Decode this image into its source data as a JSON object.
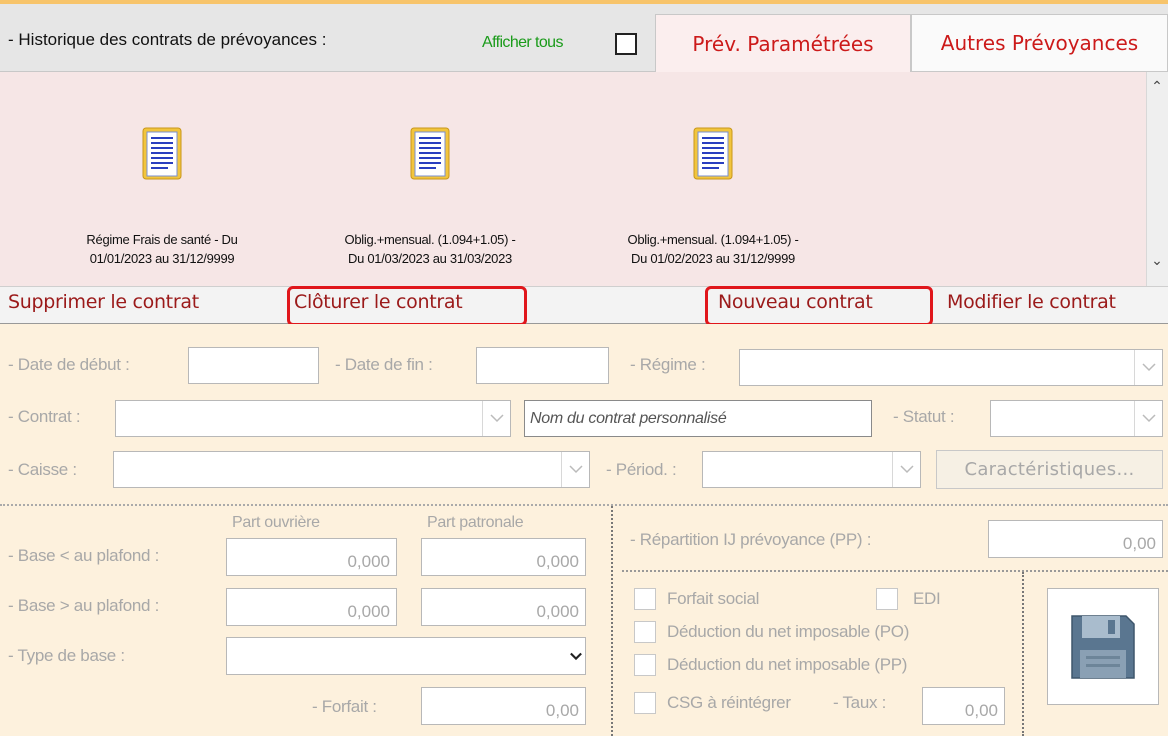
{
  "header": {
    "title": "- Historique des contrats de prévoyances :",
    "show_all_label": "Afficher tous"
  },
  "tabs": [
    {
      "label": "Prév. Paramétrées",
      "active": true
    },
    {
      "label": "Autres Prévoyances",
      "active": false
    }
  ],
  "contracts": [
    {
      "line1": "Régime Frais de santé - Du",
      "line2": "01/01/2023 au 31/12/9999"
    },
    {
      "line1": "Oblig.+mensual. (1.094+1.05) -",
      "line2": "Du 01/03/2023 au 31/03/2023"
    },
    {
      "line1": "Oblig.+mensual. (1.094+1.05) -",
      "line2": "Du 01/02/2023 au 31/12/9999"
    }
  ],
  "actions": {
    "delete": "Supprimer le contrat",
    "close": "Clôturer le contrat",
    "new": "Nouveau contrat",
    "edit": "Modifier le contrat"
  },
  "form": {
    "date_debut_label": "- Date de début :",
    "date_fin_label": "- Date de fin :",
    "regime_label": "- Régime :",
    "contrat_label": "- Contrat :",
    "contrat_placeholder": "Nom du contrat personnalisé",
    "statut_label": "- Statut :",
    "caisse_label": "- Caisse :",
    "period_label": "- Périod. :",
    "caracteristiques": "Caractéristiques...",
    "part_ouvriere": "Part ouvrière",
    "part_patronale": "Part patronale",
    "base_inf_label": "- Base < au plafond :",
    "base_inf_ouv": "0,000",
    "base_inf_pat": "0,000",
    "base_sup_label": "- Base > au plafond :",
    "base_sup_ouv": "0,000",
    "base_sup_pat": "0,000",
    "type_base_label": "- Type de base :",
    "forfait_label": "- Forfait :",
    "forfait_value": "0,00",
    "repartition_label": "- Répartition IJ prévoyance (PP) :",
    "repartition_value": "0,00",
    "forfait_social": "Forfait social",
    "edi": "EDI",
    "deduction_po": "Déduction du net imposable (PO)",
    "deduction_pp": "Déduction du net imposable (PP)",
    "csg": "CSG à réintégrer",
    "taux_label": "- Taux :",
    "taux_value": "0,00"
  },
  "colors": {
    "tab_text": "#cc1a1a",
    "action_text": "#9b1a1a",
    "highlight_box": "#e0161b",
    "show_all_text": "#1a9b1a",
    "form_bg": "#fdf1dd",
    "icons_bg": "#f6e6e6"
  }
}
